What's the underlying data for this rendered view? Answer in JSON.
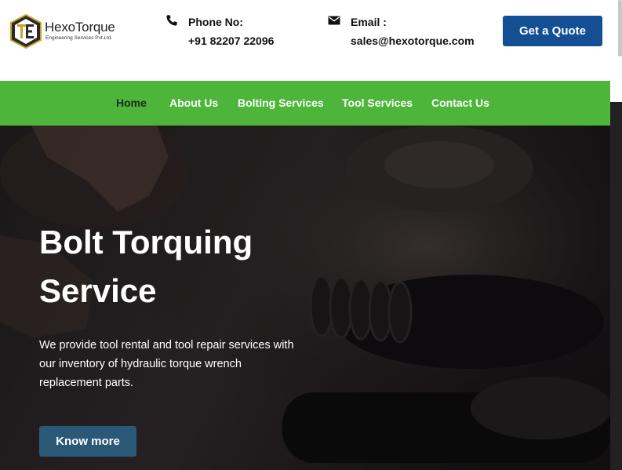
{
  "brand": {
    "name": "HexoTorque",
    "subtitle": "Engineering Services Pvt.Ltd."
  },
  "contact": {
    "phone_label": "Phone No:",
    "phone_value": "+91 82207 22096",
    "email_label": "Email :",
    "email_value": "sales@hexotorque.com"
  },
  "header": {
    "quote_button": "Get a Quote"
  },
  "nav": {
    "items": [
      {
        "label": "Home",
        "active": true
      },
      {
        "label": "About Us",
        "active": false
      },
      {
        "label": "Bolting Services",
        "active": false
      },
      {
        "label": "Tool Services",
        "active": false
      },
      {
        "label": "Contact Us",
        "active": false
      }
    ]
  },
  "hero": {
    "title": "Bolt Torquing Service",
    "description": "We provide tool rental and tool repair services with our inventory of hydraulic torque wrench replacement parts.",
    "button": "Know more"
  },
  "colors": {
    "nav_green": "#4cb53a",
    "quote_blue": "#154f93",
    "hero_button": "#2b5877",
    "logo_gold": "#c9a227",
    "logo_dark": "#2a2a2a"
  },
  "icons": {
    "phone": "phone-icon",
    "email": "envelope-icon"
  }
}
